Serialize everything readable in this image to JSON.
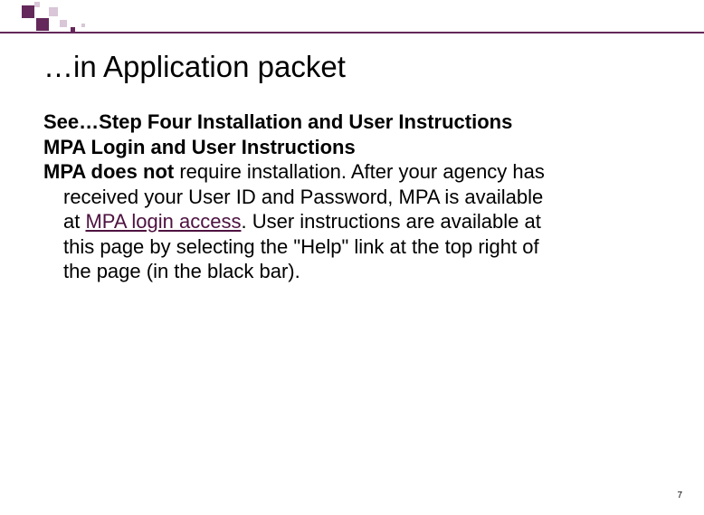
{
  "decoration": {
    "accent_color": "#64285a",
    "light_color": "#d9c6d7",
    "rule_color": "#64285a"
  },
  "title": "…in Application packet",
  "body": {
    "line1": "See…Step Four Installation and User Instructions",
    "line2": "MPA Login and User Instructions",
    "line3_bold": "MPA does not",
    "line3_rest": " require installation. After your agency has",
    "line4": "received your User ID and Password, MPA is available",
    "line5_pre": "at ",
    "line5_link": "MPA login access",
    "line5_post": ". User instructions are available at",
    "line6": "this page by selecting the \"Help\" link at the top right of",
    "line7": "the page (in the black bar)."
  },
  "page_number": "7"
}
